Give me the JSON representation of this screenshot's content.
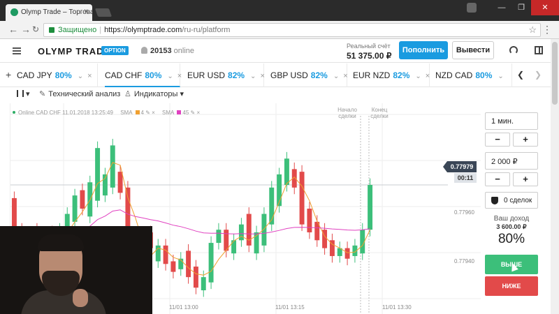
{
  "browser": {
    "tab_title": "Olymp Trade – Торгова",
    "close_glyph": "×",
    "secure_label": "Защищено",
    "url_host": "https://olymptrade.com",
    "url_path": "/ru-ru/platform",
    "window_controls": [
      "—",
      "❐",
      "✕"
    ]
  },
  "header": {
    "logo": "OLYMP TRADE",
    "logo_badge": "OPTION",
    "online_count": "20153",
    "online_label": "online",
    "account_label": "Реальный счёт",
    "account_balance": "51 375.00 ₽",
    "deposit_label": "Пополнить",
    "withdraw_label": "Вывести"
  },
  "asset_tabs": [
    {
      "name": "CAD JPY",
      "pct": "80%",
      "active": false
    },
    {
      "name": "CAD CHF",
      "pct": "80%",
      "active": true
    },
    {
      "name": "EUR USD",
      "pct": "82%",
      "active": false
    },
    {
      "name": "GBP USD",
      "pct": "82%",
      "active": false
    },
    {
      "name": "EUR NZD",
      "pct": "82%",
      "active": false
    },
    {
      "name": "NZD CAD",
      "pct": "80%",
      "active": false
    }
  ],
  "toolbar": {
    "tech_analysis": "Технический анализ",
    "indicators": "Индикаторы"
  },
  "chart": {
    "legend_title": "Online CAD CHF",
    "legend_time": "11.01.2018 13:25:49",
    "sma1_label": "SMA",
    "sma1_period": "4",
    "sma2_label": "SMA",
    "sma2_period": "45",
    "start_label_1": "Начало",
    "start_label_2": "сделки",
    "end_label_1": "Конец",
    "end_label_2": "сделки",
    "current_price": "0.77979",
    "timer": "00:11",
    "y_ticks": [
      "0.77960",
      "0.77940"
    ],
    "x_ticks": [
      "11/01 13:00",
      "11/01 13:15",
      "11/01 13:30"
    ],
    "colors": {
      "up": "#3cbf7a",
      "down": "#e24a4a",
      "sma_fast": "#f0a030",
      "sma_slow": "#e040c0",
      "grid": "#ededed"
    }
  },
  "chart_data": {
    "type": "candlestick",
    "candles": [
      {
        "dir": "down",
        "o": 0.77974,
        "c": 0.7796
      },
      {
        "dir": "down",
        "o": 0.77962,
        "c": 0.77955
      },
      {
        "dir": "up",
        "o": 0.77952,
        "c": 0.7796
      },
      {
        "dir": "down",
        "o": 0.77962,
        "c": 0.77954
      },
      {
        "dir": "up",
        "o": 0.77951,
        "c": 0.77958
      },
      {
        "dir": "down",
        "o": 0.77961,
        "c": 0.77955
      },
      {
        "dir": "up",
        "o": 0.77953,
        "c": 0.77962
      },
      {
        "dir": "up",
        "o": 0.77958,
        "c": 0.77968
      },
      {
        "dir": "up",
        "o": 0.77965,
        "c": 0.77975
      },
      {
        "dir": "down",
        "o": 0.77977,
        "c": 0.7797
      },
      {
        "dir": "up",
        "o": 0.77967,
        "c": 0.7798
      },
      {
        "dir": "up",
        "o": 0.77973,
        "c": 0.77993
      },
      {
        "dir": "up",
        "o": 0.77975,
        "c": 0.77983
      },
      {
        "dir": "up",
        "o": 0.77978,
        "c": 0.77994
      },
      {
        "dir": "down",
        "o": 0.77984,
        "c": 0.77976
      },
      {
        "dir": "down",
        "o": 0.77978,
        "c": 0.77944
      },
      {
        "dir": "down",
        "o": 0.77957,
        "c": 0.77952
      },
      {
        "dir": "up",
        "o": 0.77953,
        "c": 0.77957
      },
      {
        "dir": "down",
        "o": 0.77961,
        "c": 0.77955
      },
      {
        "dir": "up",
        "o": 0.7795,
        "c": 0.77956
      },
      {
        "dir": "down",
        "o": 0.77956,
        "c": 0.77949
      },
      {
        "dir": "down",
        "o": 0.7795,
        "c": 0.77946
      },
      {
        "dir": "up",
        "o": 0.77947,
        "c": 0.77951
      },
      {
        "dir": "down",
        "o": 0.77954,
        "c": 0.77944
      },
      {
        "dir": "down",
        "o": 0.77948,
        "c": 0.7794
      },
      {
        "dir": "up",
        "o": 0.77939,
        "c": 0.77944
      },
      {
        "dir": "up",
        "o": 0.77942,
        "c": 0.77957
      },
      {
        "dir": "up",
        "o": 0.77957,
        "c": 0.77962
      },
      {
        "dir": "down",
        "o": 0.77962,
        "c": 0.77954
      },
      {
        "dir": "up",
        "o": 0.77953,
        "c": 0.77958
      },
      {
        "dir": "up",
        "o": 0.77958,
        "c": 0.77964
      },
      {
        "dir": "down",
        "o": 0.77968,
        "c": 0.77956
      },
      {
        "dir": "up",
        "o": 0.77953,
        "c": 0.77961
      },
      {
        "dir": "up",
        "o": 0.77956,
        "c": 0.77968
      },
      {
        "dir": "up",
        "o": 0.77964,
        "c": 0.77978
      },
      {
        "dir": "up",
        "o": 0.77971,
        "c": 0.77983
      },
      {
        "dir": "up",
        "o": 0.77979,
        "c": 0.77989
      },
      {
        "dir": "down",
        "o": 0.77985,
        "c": 0.77978
      },
      {
        "dir": "down",
        "o": 0.77984,
        "c": 0.77964
      },
      {
        "dir": "down",
        "o": 0.7797,
        "c": 0.77961
      },
      {
        "dir": "down",
        "o": 0.77965,
        "c": 0.77958
      },
      {
        "dir": "down",
        "o": 0.77962,
        "c": 0.77955
      },
      {
        "dir": "down",
        "o": 0.77958,
        "c": 0.77952
      },
      {
        "dir": "up",
        "o": 0.77952,
        "c": 0.77955
      },
      {
        "dir": "down",
        "o": 0.77955,
        "c": 0.77951
      },
      {
        "dir": "up",
        "o": 0.77952,
        "c": 0.77956
      },
      {
        "dir": "up",
        "o": 0.77953,
        "c": 0.77962
      },
      {
        "dir": "up",
        "o": 0.77962,
        "c": 0.77979
      }
    ],
    "ylim": [
      0.7793,
      0.7801
    ],
    "x_ticks": [
      "11/01 13:00",
      "11/01 13:15",
      "11/01 13:30"
    ],
    "y_ticks": [
      0.7796,
      0.7794
    ],
    "current_price": 0.77979
  },
  "panel": {
    "time_value": "1 мин.",
    "minus": "−",
    "plus": "+",
    "amount_value": "2 000 ₽",
    "deals": "0 сделок",
    "income_label": "Ваш доход",
    "income_value": "3 600.00 ₽",
    "income_pct": "80%",
    "up_label": "ВЫШЕ",
    "down_label": "НИЖЕ"
  }
}
